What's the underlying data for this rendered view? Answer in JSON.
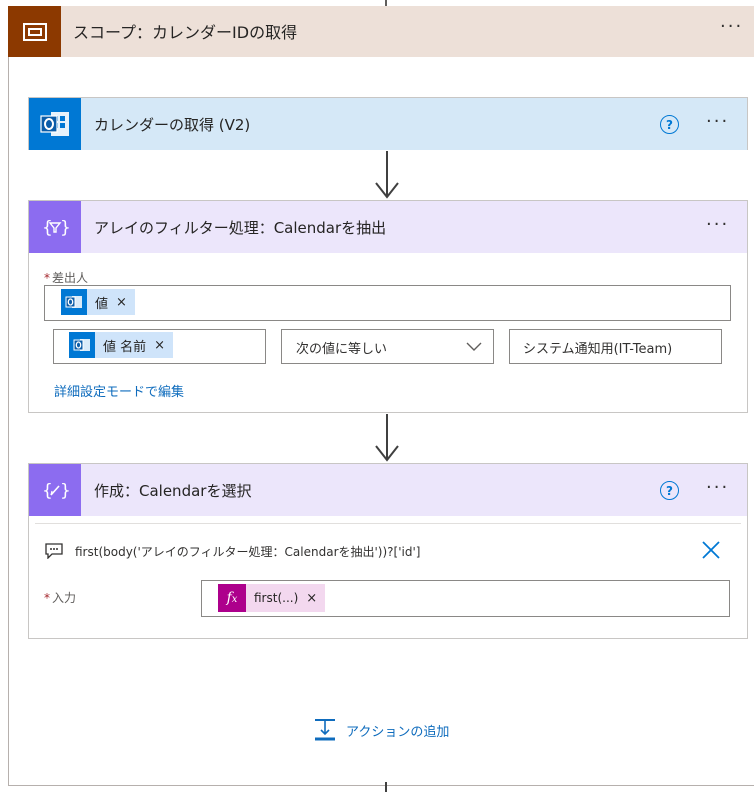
{
  "scope": {
    "title": "スコープ：カレンダーIDの取得",
    "more": "···"
  },
  "actions": {
    "get_calendars": {
      "title": "カレンダーの取得 (V2)",
      "help": "?",
      "more": "···"
    },
    "filter": {
      "title": "アレイのフィルター処理：Calendarを抽出",
      "more": "···",
      "from_label": "差出人",
      "from_token": "値",
      "cond_left_token": "値 名前",
      "cond_operator": "次の値に等しい",
      "cond_value": "システム通知用(IT-Team)",
      "advanced_link": "詳細設定モードで編集"
    },
    "compose": {
      "title": "作成：Calendarを選択",
      "help": "?",
      "more": "···",
      "expression": "first(body('アレイのフィルター処理：Calendarを抽出'))?['id']",
      "input_label": "入力",
      "input_token": "first(...)"
    }
  },
  "add_action": "アクションの追加",
  "token_close": "×",
  "required_mark": "*",
  "colors": {
    "scope_header_bg": "#ede0d8",
    "scope_icon_bg": "#8c3900",
    "outlook_header_bg": "#d5e8f7",
    "outlook_icon_bg": "#0078d4",
    "data_op_header_bg": "#ece6fb",
    "data_op_icon_bg": "#8c6cf0",
    "expression_token_bg": "#f3d8ef",
    "expression_icon_bg": "#ad008c",
    "link": "#0f6cbd"
  }
}
